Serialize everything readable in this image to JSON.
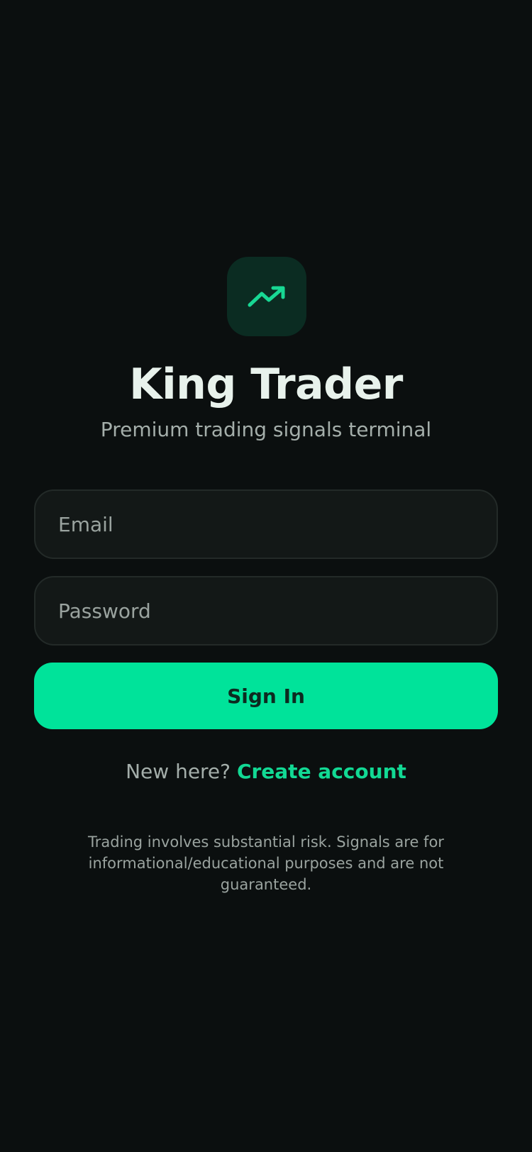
{
  "app": {
    "logo_icon": "trending-up-icon",
    "title": "King Trader",
    "subtitle": "Premium trading signals terminal"
  },
  "form": {
    "email_placeholder": "Email",
    "password_placeholder": "Password",
    "email_value": "",
    "password_value": "",
    "submit_label": "Sign In"
  },
  "signup": {
    "prompt": "New here?",
    "link_label": "Create account"
  },
  "disclaimer": "Trading involves substantial risk. Signals are for informational/educational purposes and are not guaranteed.",
  "colors": {
    "background": "#0b0f0f",
    "accent": "#00e39a",
    "logo_tile": "#0b2c22",
    "field_background": "#131817",
    "muted_text": "#a4aeaa"
  }
}
